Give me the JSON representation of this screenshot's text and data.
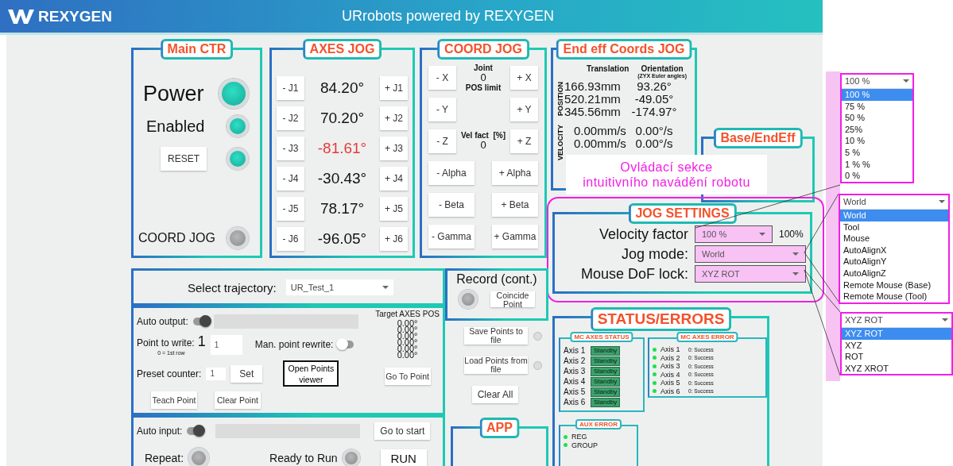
{
  "header": {
    "logo": "REXYGEN",
    "title": "URrobots powered by REXYGEN"
  },
  "main_ctr": {
    "title": "Main CTR",
    "power": {
      "label": "Power",
      "on": true
    },
    "enabled": {
      "label": "Enabled",
      "on": true
    },
    "reset": {
      "label": "RESET",
      "on": true
    },
    "coord_jog": {
      "label": "COORD JOG",
      "on": false
    }
  },
  "axes_jog": {
    "title": "AXES JOG",
    "joints": [
      {
        "minus": "- J1",
        "value": "84.20°",
        "plus": "+ J1",
        "warning": false
      },
      {
        "minus": "- J2",
        "value": "70.20°",
        "plus": "+ J2",
        "warning": false
      },
      {
        "minus": "- J3",
        "value": "-81.61°",
        "plus": "+ J3",
        "warning": true
      },
      {
        "minus": "- J4",
        "value": "-30.43°",
        "plus": "+ J4",
        "warning": false
      },
      {
        "minus": "- J5",
        "value": "78.17°",
        "plus": "+ J5",
        "warning": false
      },
      {
        "minus": "- J6",
        "value": "-96.05°",
        "plus": "+ J6",
        "warning": false
      }
    ]
  },
  "coord_jog": {
    "title": "COORD JOG",
    "joint_label": "Joint",
    "joint_value": "0",
    "pos_limit_label": "POS limit",
    "vel_label": "Vel fact  [%]",
    "vel_value": "0",
    "linear": [
      {
        "minus": "- X",
        "plus": "+ X"
      },
      {
        "minus": "- Y",
        "plus": "+ Y"
      },
      {
        "minus": "- Z",
        "plus": "+ Z"
      }
    ],
    "angular": [
      {
        "minus": "- Alpha",
        "plus": "+ Alpha"
      },
      {
        "minus": "- Beta",
        "plus": "+ Beta"
      },
      {
        "minus": "- Gamma",
        "plus": "+ Gamma"
      }
    ]
  },
  "end_eff": {
    "title": "End eff Coords JOG",
    "translation_label": "Translation",
    "orientation_label": "Orientation",
    "orientation_note": "(ZYX Euler angles)",
    "position_label": "POSITION",
    "velocity_label": "VELOCITY",
    "position_rows": [
      {
        "translation": "166.93mm",
        "orientation": "93.26°"
      },
      {
        "translation": "520.21mm",
        "orientation": "-49.05°"
      },
      {
        "translation": "345.56mm",
        "orientation": "-174.97°"
      }
    ],
    "velocity_rows": [
      {
        "translation": "0.00mm/s",
        "orientation": "0.00°/s"
      },
      {
        "translation": "0.00mm/s",
        "orientation": "0.00°/s"
      }
    ]
  },
  "base_endeff": {
    "title": "Base/EndEff"
  },
  "annotation": {
    "lines": [
      "Ovládací sekce",
      "intuitivního navádění robotu"
    ]
  },
  "jog_settings": {
    "title": "JOG SETTINGS",
    "velocity_factor": {
      "label": "Velocity factor",
      "value": "100 %",
      "reading": "100%"
    },
    "jog_mode": {
      "label": "Jog mode:",
      "value": "World"
    },
    "dof_lock": {
      "label": "Mouse DoF lock:",
      "value": "XYZ ROT"
    }
  },
  "dropdown_lists": [
    {
      "value": "100 %",
      "options": [
        {
          "label": "100 %",
          "selected": true
        },
        {
          "label": "75 %",
          "selected": false
        },
        {
          "label": "50 %",
          "selected": false
        },
        {
          "label": "25%",
          "selected": false
        },
        {
          "label": "10 %",
          "selected": false
        },
        {
          "label": "5 %",
          "selected": false
        },
        {
          "label": "1 % %",
          "selected": false
        },
        {
          "label": "0 %",
          "selected": false
        }
      ]
    },
    {
      "value": "World",
      "options": [
        {
          "label": "World",
          "selected": true
        },
        {
          "label": "Tool",
          "selected": false
        },
        {
          "label": "Mouse",
          "selected": false
        },
        {
          "label": "AutoAlignX",
          "selected": false
        },
        {
          "label": "AutoAlignY",
          "selected": false
        },
        {
          "label": "AutoAlignZ",
          "selected": false
        },
        {
          "label": "Remote Mouse (Base)",
          "selected": false
        },
        {
          "label": "Remote Mouse (Tool)",
          "selected": false
        }
      ]
    },
    {
      "value": "XYZ ROT",
      "options": [
        {
          "label": "XYZ ROT",
          "selected": true
        },
        {
          "label": "XYZ",
          "selected": false
        },
        {
          "label": "ROT",
          "selected": false
        },
        {
          "label": "XYZ XROT",
          "selected": false
        }
      ]
    }
  ],
  "trajectory": {
    "label": "Select trajectory:",
    "value": "UR_Test_1"
  },
  "recording": {
    "auto_output": {
      "label": "Auto output:",
      "on": true
    },
    "point_to_write": {
      "label": "Point to write:",
      "value": "1",
      "note": "0 = 1st row",
      "input": "1"
    },
    "man_rewrite": {
      "label": "Man. point rewrite:",
      "on": false
    },
    "preset_counter": {
      "label": "Preset counter:",
      "input": "1",
      "button": "Set"
    },
    "open_viewer": "Open Points viewer",
    "teach": "Teach Point",
    "clear": "Clear Point",
    "target_label": "Target AXES POS",
    "target_values": [
      "0.00°",
      "0.00°",
      "0.00°",
      "0.00°",
      "0.00°",
      "0.00°"
    ],
    "go_to_point": "Go To Point"
  },
  "record": {
    "title": "Record (cont.)",
    "on": false,
    "button": "Coincide Point"
  },
  "file_buttons": [
    {
      "label": "Save Points to file",
      "on": false
    },
    {
      "label": "Load Points from file",
      "on": false
    }
  ],
  "clear_all": "Clear All",
  "playback": {
    "auto_input": {
      "label": "Auto input:",
      "on": true
    },
    "go_to_start": "Go to start",
    "repeat": {
      "label": "Repeat:",
      "on": false
    },
    "ready": {
      "label": "Ready to Run",
      "on": false
    },
    "run": "RUN"
  },
  "app": {
    "title": "APP"
  },
  "status": {
    "title": "STATUS/ERRORS",
    "axes_status": {
      "title": "MC AXES STATUS",
      "rows": [
        {
          "axis": "Axis 1",
          "state": "Standby"
        },
        {
          "axis": "Axis 2",
          "state": "Standby"
        },
        {
          "axis": "Axis 3",
          "state": "Standby"
        },
        {
          "axis": "Axis 4",
          "state": "Standby"
        },
        {
          "axis": "Axis 5",
          "state": "Standby"
        },
        {
          "axis": "Axis 6",
          "state": "Standby"
        }
      ]
    },
    "axes_error": {
      "title": "MC AXES ERROR",
      "rows": [
        {
          "axis": "Axis 1",
          "message": "0: Success",
          "color": "#22e04a"
        },
        {
          "axis": "Axis 2",
          "message": "0: Success",
          "color": "#22e04a"
        },
        {
          "axis": "Axis 3",
          "message": "0: Success",
          "color": "#22e04a"
        },
        {
          "axis": "Axis 4",
          "message": "0: Success",
          "color": "#22e04a"
        },
        {
          "axis": "Axis 5",
          "message": "0: Success",
          "color": "#22e04a"
        },
        {
          "axis": "Axis 6",
          "message": "0: Success",
          "color": "#22e04a"
        }
      ]
    },
    "aux_error": {
      "title": "AUX ERROR",
      "rows": [
        {
          "label": "REG",
          "color": "#22e04a"
        },
        {
          "label": "GROUP",
          "color": "#22e04a"
        }
      ]
    }
  }
}
